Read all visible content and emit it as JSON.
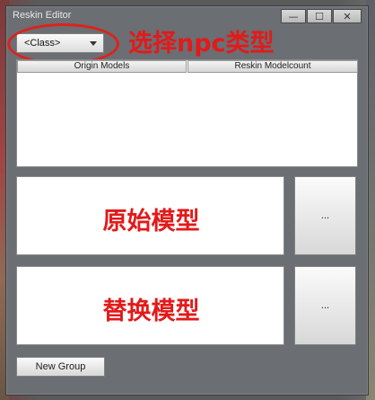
{
  "window": {
    "title": "Reskin Editor",
    "controls": {
      "minimize": "—",
      "maximize": "☐",
      "close": "✕"
    }
  },
  "class_select": {
    "value": "<Class>"
  },
  "annotations": {
    "select_npc_type": "选择npc类型",
    "origin_model": "原始模型",
    "replace_model": "替换模型"
  },
  "table": {
    "columns": [
      "Origin Models",
      "Reskin Modelcount"
    ],
    "rows": []
  },
  "browse_buttons": {
    "origin": "...",
    "replace": "..."
  },
  "new_group_button": "New Group",
  "colors": {
    "annotation": "#e21a1a",
    "window_bg": "#6b6e72"
  }
}
